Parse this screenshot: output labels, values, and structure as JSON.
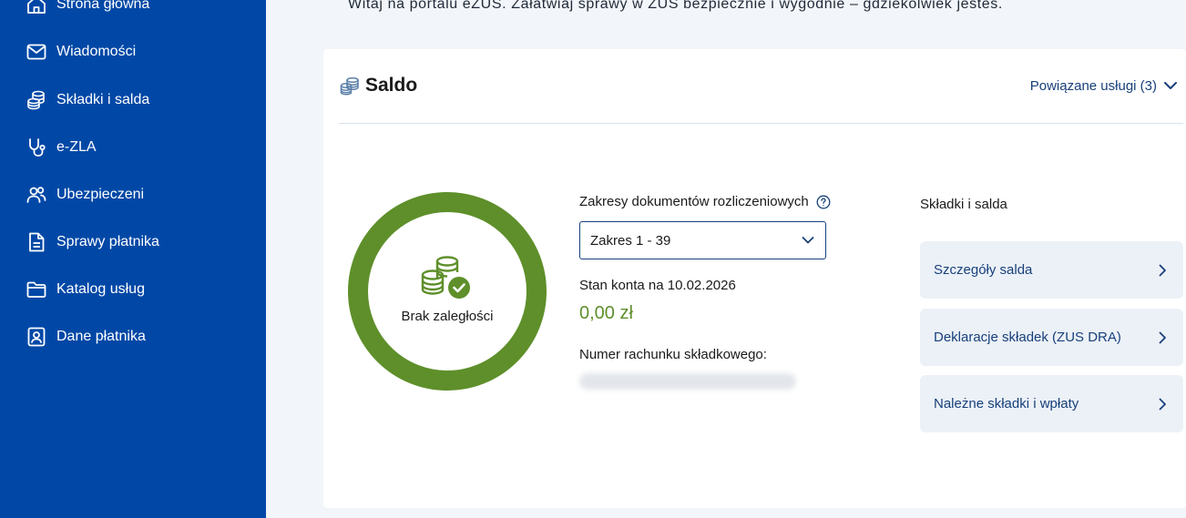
{
  "welcome": "Witaj na portalu eZUS. Załatwiaj sprawy w ZUS bezpiecznie i wygodnie – gdziekolwiek jesteś.",
  "sidebar": {
    "items": [
      {
        "label": "Strona główna",
        "icon": "home-icon"
      },
      {
        "label": "Wiadomości",
        "icon": "envelope-icon"
      },
      {
        "label": "Składki i salda",
        "icon": "coins-icon"
      },
      {
        "label": "e-ZLA",
        "icon": "stethoscope-icon"
      },
      {
        "label": "Ubezpieczeni",
        "icon": "users-icon"
      },
      {
        "label": "Sprawy płatnika",
        "icon": "document-icon"
      },
      {
        "label": "Katalog usług",
        "icon": "folder-icon"
      },
      {
        "label": "Dane płatnika",
        "icon": "id-card-icon"
      }
    ]
  },
  "card": {
    "title": "Saldo",
    "related_link": "Powiązane usługi (3)",
    "status_label": "Brak zaległości",
    "ranges_label": "Zakresy dokumentów rozliczeniowych",
    "ranges_select_value": "Zakres 1 - 39",
    "balance_date_label": "Stan konta na 10.02.2026",
    "balance_amount": "0,00 zł",
    "account_number_label": "Numer rachunku składkowego:",
    "right_title": "Składki i salda",
    "links": [
      {
        "label": "Szczegóły salda"
      },
      {
        "label": "Deklaracje składek (ZUS DRA)"
      },
      {
        "label": "Należne składki i wpłaty"
      }
    ]
  },
  "colors": {
    "sidebar_bg": "#0148a6",
    "accent_green": "#5e8f2a",
    "link_blue": "#17407b",
    "link_card_bg": "#ecf1f7"
  }
}
